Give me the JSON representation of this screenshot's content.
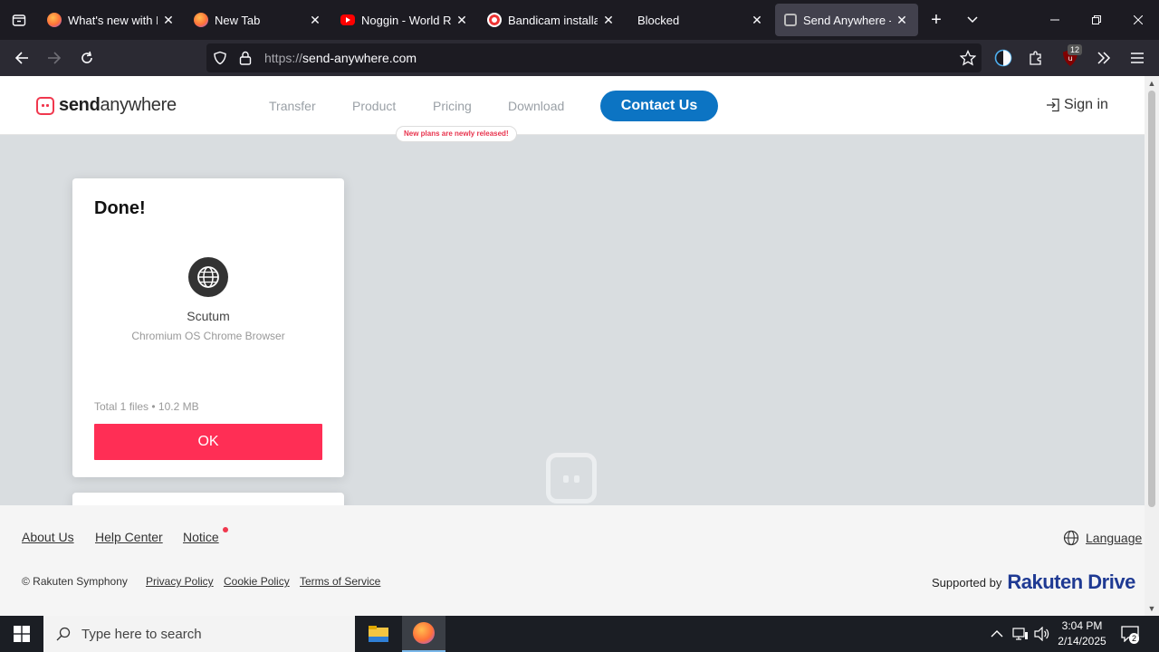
{
  "browser": {
    "tabs": [
      {
        "title": "What's new with Firefox",
        "favicon": "firefox-icon",
        "color": "#ff7139"
      },
      {
        "title": "New Tab",
        "favicon": "firefox-icon",
        "color": "#ff7139"
      },
      {
        "title": "Noggin - World Running",
        "favicon": "youtube-icon",
        "color": "#ff0000"
      },
      {
        "title": "Bandicam installation",
        "favicon": "bandicam-icon",
        "color": "#e33"
      },
      {
        "title": "Blocked",
        "favicon": "",
        "color": ""
      },
      {
        "title": "Send Anywhere - File",
        "favicon": "sendanywhere-icon",
        "color": "#f0384e"
      }
    ],
    "url_proto": "https://",
    "url_host": "send-anywhere.com",
    "extension_badge": "12"
  },
  "site": {
    "logo_bold": "send",
    "logo_light": "anywhere",
    "nav": [
      "Transfer",
      "Product",
      "Pricing",
      "Download"
    ],
    "pricing_badge": "New plans are newly released!",
    "contact_label": "Contact Us",
    "signin_label": "Sign in",
    "brand_color": "#f0384e",
    "accent_blue": "#0c74c3"
  },
  "card": {
    "title": "Done!",
    "device_name": "Scutum",
    "device_sub": "Chromium OS Chrome Browser",
    "total": "Total 1 files • 10.2 MB",
    "ok_label": "OK",
    "ok_color": "#ff2e55"
  },
  "footer": {
    "links": [
      "About Us",
      "Help Center",
      "Notice"
    ],
    "language": "Language",
    "copyright": "© Rakuten Symphony",
    "legal": [
      "Privacy Policy",
      "Cookie Policy",
      "Terms of Service"
    ],
    "supported_by": "Supported by",
    "partner_a": "Rakuten ",
    "partner_b": "Drive"
  },
  "taskbar": {
    "search_placeholder": "Type here to search",
    "time": "3:04 PM",
    "date": "2/14/2025",
    "notifications": "2"
  }
}
